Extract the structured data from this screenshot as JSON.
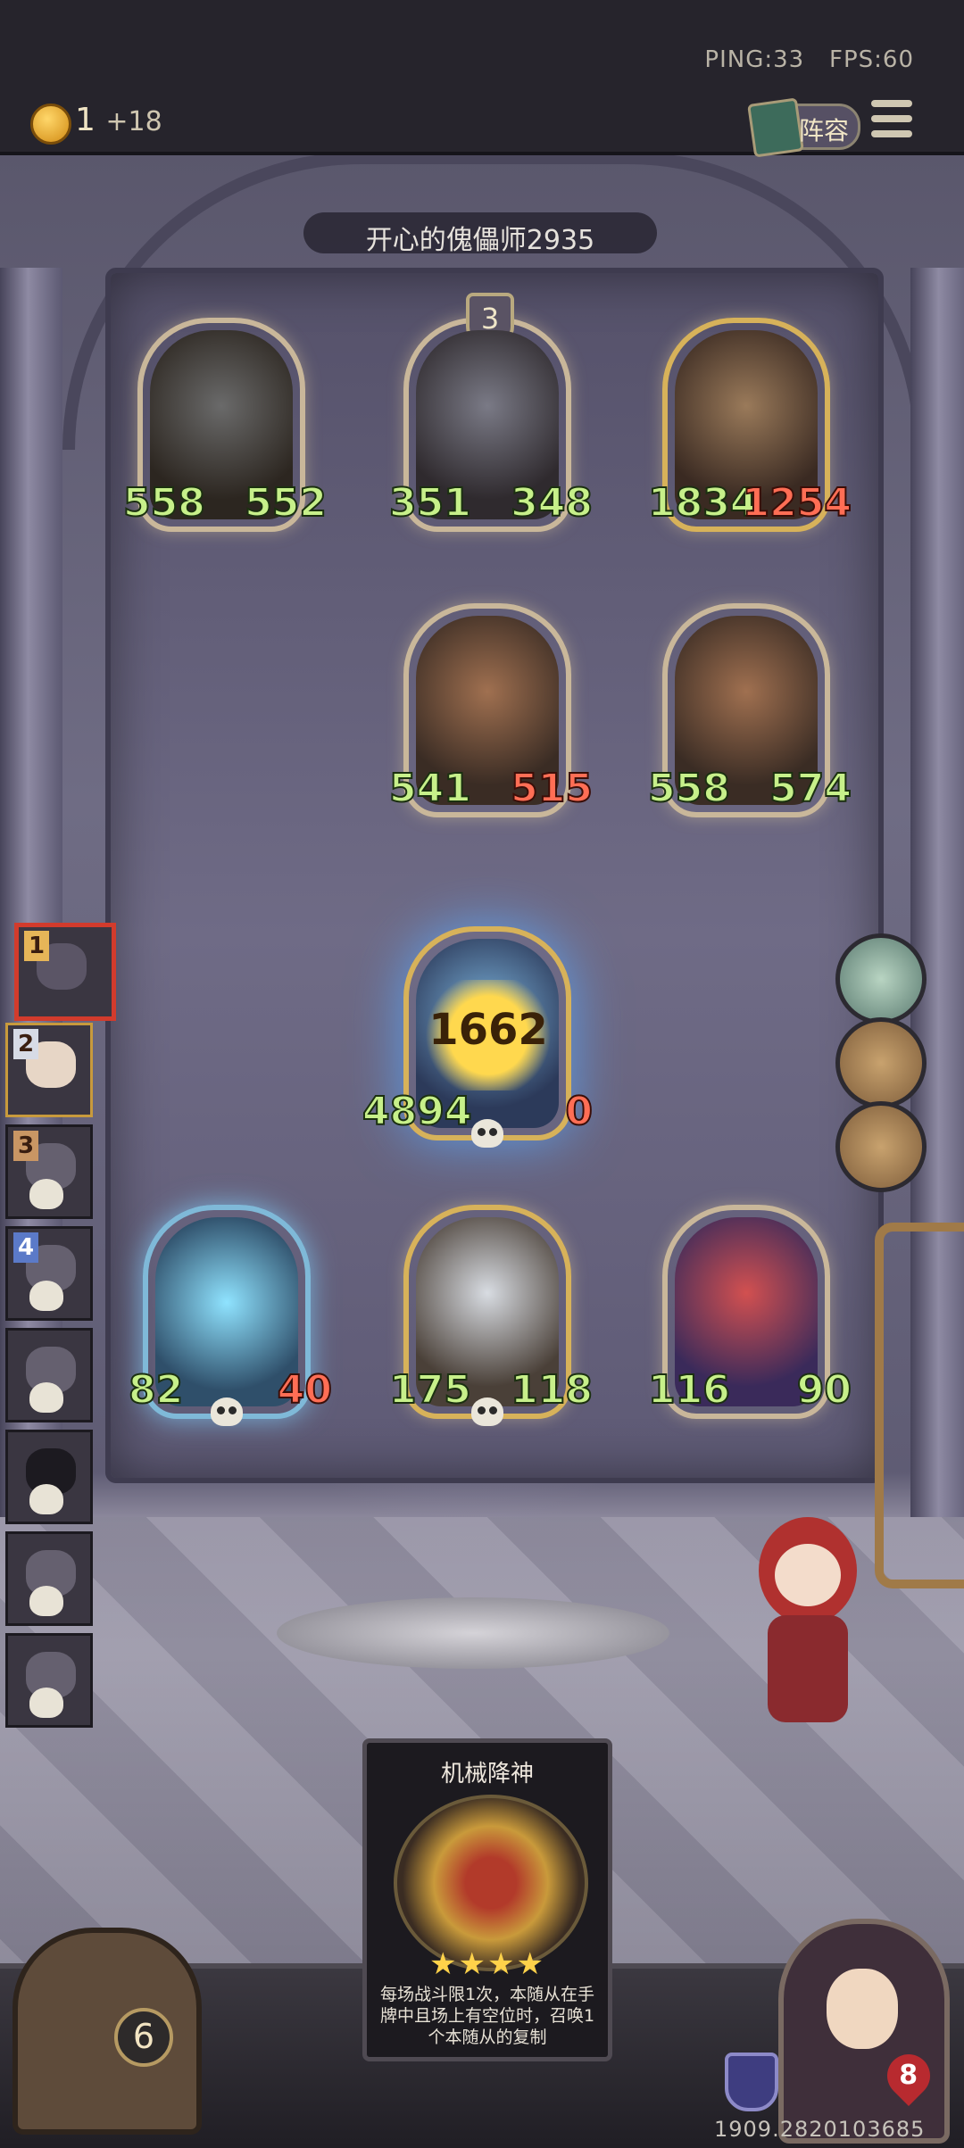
{
  "hud": {
    "ping": "PING:33",
    "fps": "FPS:60",
    "coins": "1",
    "coin_income": "+18",
    "lineup_label": "阵容"
  },
  "opponent": {
    "name": "开心的傀儡师2935",
    "tier": "3"
  },
  "enemy_board": [
    {
      "attack": "558",
      "health": "552",
      "damaged": false
    },
    {
      "attack": "351",
      "health": "348",
      "damaged": false
    },
    {
      "attack": "1834",
      "health": "1254",
      "damaged": true
    },
    {
      "attack": "541",
      "health": "515",
      "damaged": true
    },
    {
      "attack": "558",
      "health": "574",
      "damaged": false
    }
  ],
  "combat": {
    "attacker_attack": "4894",
    "attacker_health": "0",
    "damage": "1662"
  },
  "player_board": [
    {
      "attack": "82",
      "health": "40",
      "damaged": true
    },
    {
      "attack": "175",
      "health": "118",
      "damaged": false
    },
    {
      "attack": "116",
      "health": "90",
      "damaged": false
    }
  ],
  "leaderboard": [
    {
      "rank": "1",
      "dead": false
    },
    {
      "rank": "2",
      "dead": false
    },
    {
      "rank": "3",
      "dead": true
    },
    {
      "rank": "4",
      "dead": true
    },
    {
      "rank": "",
      "dead": true
    },
    {
      "rank": "",
      "dead": true
    },
    {
      "rank": "",
      "dead": true
    },
    {
      "rank": "",
      "dead": true
    }
  ],
  "hand_card": {
    "title": "机械降神",
    "stars": "★★★★",
    "description": "每场战斗限1次，本随从在手牌中且场上有空位时，召唤1个本随从的复制"
  },
  "shop": {
    "tier": "6"
  },
  "hero": {
    "health": "8"
  },
  "seed": "1909.2820103685"
}
